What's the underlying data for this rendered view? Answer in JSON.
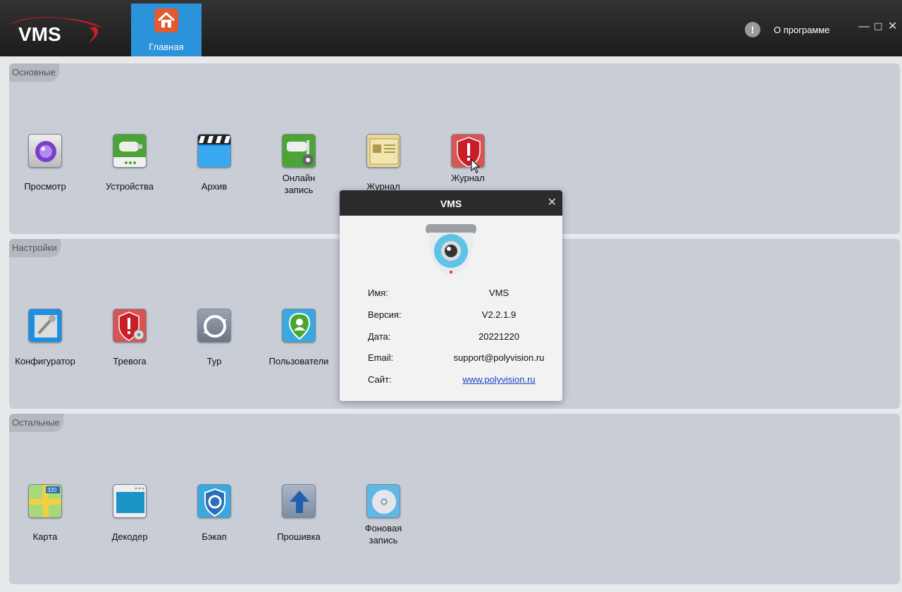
{
  "app": {
    "logo": "VMS",
    "accent": "#2a93d9"
  },
  "header": {
    "home_tab": "Главная",
    "about": "О программе"
  },
  "sections": {
    "basic": {
      "title": "Основные",
      "items": [
        {
          "label": "Просмотр",
          "icon": "view-icon"
        },
        {
          "label": "Устройства",
          "icon": "devices-icon"
        },
        {
          "label": "Архив",
          "icon": "archive-icon"
        },
        {
          "label": "Онлайн\nзапись",
          "icon": "online-record-icon"
        },
        {
          "label": "Журнал",
          "icon": "log-icon"
        },
        {
          "label": "Журнал\nтревог",
          "icon": "alarm-log-icon"
        }
      ]
    },
    "settings": {
      "title": "Настройки",
      "items": [
        {
          "label": "Конфигуратор",
          "icon": "config-icon"
        },
        {
          "label": "Тревога",
          "icon": "alarm-icon"
        },
        {
          "label": "Тур",
          "icon": "tour-icon"
        },
        {
          "label": "Пользователи",
          "icon": "users-icon"
        }
      ]
    },
    "other": {
      "title": "Остальные",
      "items": [
        {
          "label": "Карта",
          "icon": "map-icon"
        },
        {
          "label": "Декодер",
          "icon": "decoder-icon"
        },
        {
          "label": "Бэкап",
          "icon": "backup-icon"
        },
        {
          "label": "Прошивка",
          "icon": "firmware-icon"
        },
        {
          "label": "Фоновая\nзапись",
          "icon": "background-record-icon"
        }
      ]
    }
  },
  "dialog": {
    "title": "VMS",
    "rows": [
      {
        "key": "Имя:",
        "value": "VMS"
      },
      {
        "key": "Версия:",
        "value": "V2.2.1.9"
      },
      {
        "key": "Дата:",
        "value": "20221220"
      },
      {
        "key": "Email:",
        "value": "support@polyvision.ru"
      },
      {
        "key": "Сайт:",
        "value": "www.polyvision.ru"
      }
    ]
  }
}
